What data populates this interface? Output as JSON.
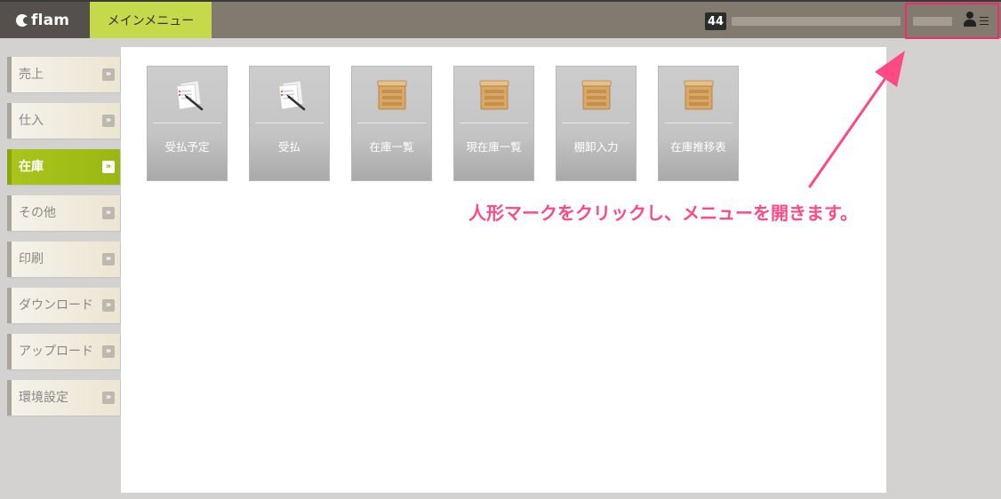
{
  "header": {
    "logo_text": "flam",
    "main_menu_tab": "メインメニュー",
    "notification_count": "44",
    "accent_color": "#c6d94a"
  },
  "sidebar": {
    "items": [
      {
        "label": "売上",
        "active": false
      },
      {
        "label": "仕入",
        "active": false
      },
      {
        "label": "在庫",
        "active": true
      },
      {
        "label": "その他",
        "active": false
      },
      {
        "label": "印刷",
        "active": false
      },
      {
        "label": "ダウンロード",
        "active": false
      },
      {
        "label": "アップロード",
        "active": false
      },
      {
        "label": "環境設定",
        "active": false
      }
    ],
    "chevron_glyph": "»"
  },
  "tiles": [
    {
      "label": "受払予定",
      "icon": "document-pen-icon"
    },
    {
      "label": "受払",
      "icon": "document-pen-icon"
    },
    {
      "label": "在庫一覧",
      "icon": "wooden-box-icon"
    },
    {
      "label": "現在庫一覧",
      "icon": "wooden-box-icon"
    },
    {
      "label": "棚卸入力",
      "icon": "wooden-box-icon"
    },
    {
      "label": "在庫推移表",
      "icon": "wooden-box-icon"
    }
  ],
  "annotation": {
    "text": "人形マークをクリックし、メニューを開きます。",
    "color": "#ff4a86"
  }
}
